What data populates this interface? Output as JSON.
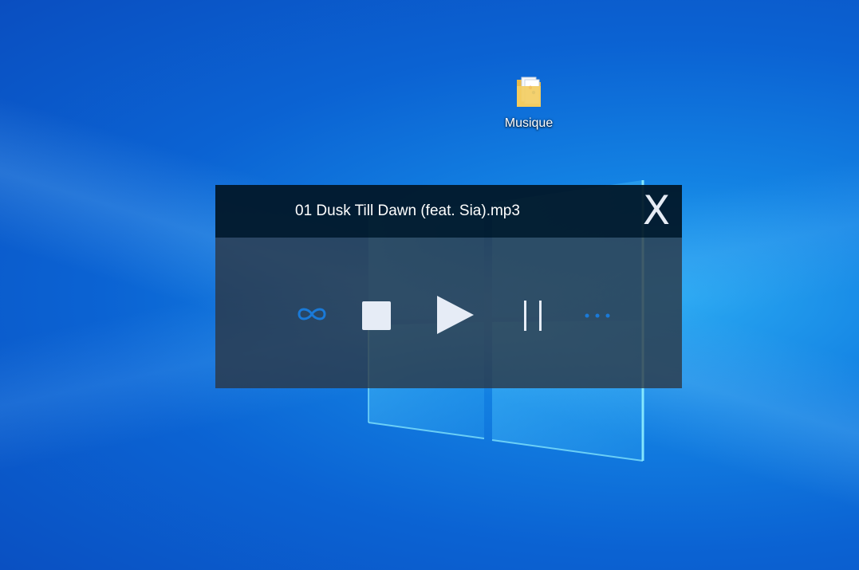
{
  "desktop": {
    "icons": [
      {
        "label": "Musique",
        "icon": "music-folder-icon"
      }
    ]
  },
  "player": {
    "track_title": "01 Dusk Till Dawn (feat. Sia).mp3",
    "close_label": "X",
    "controls": {
      "loop_icon": "infinity-loop-icon",
      "stop_icon": "stop-icon",
      "play_icon": "play-icon",
      "pause_icon": "pause-icon",
      "more_icon": "more-dots-icon"
    },
    "colors": {
      "accent": "#1a7ad8",
      "control_fill": "#e6ecf6",
      "titlebar": "#011626",
      "body": "#2c3440"
    }
  }
}
